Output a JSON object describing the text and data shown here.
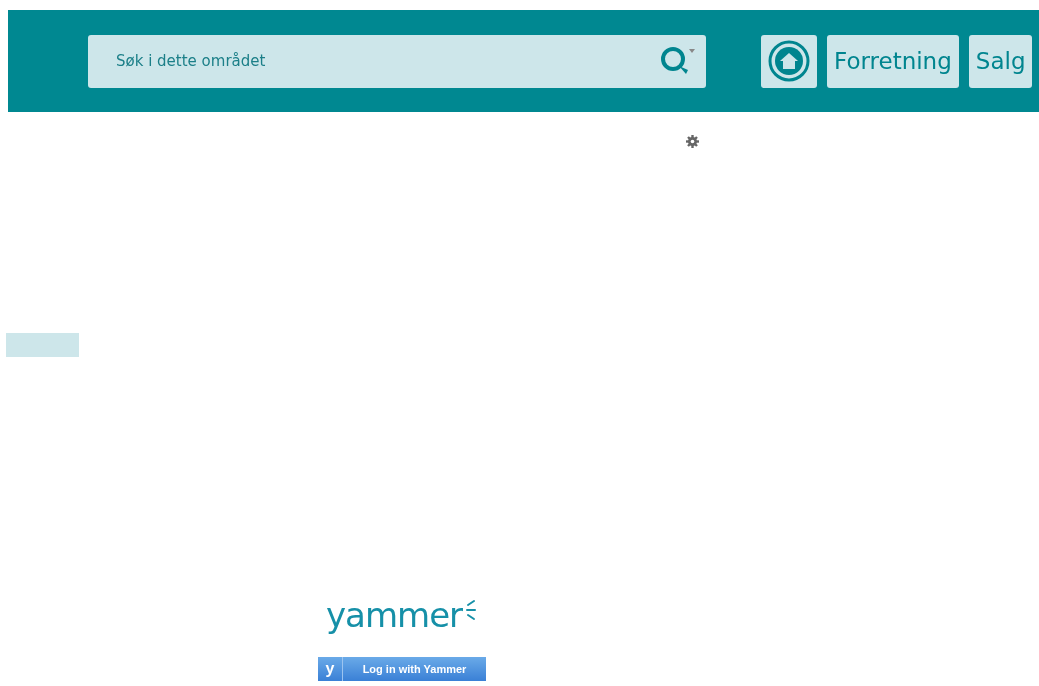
{
  "header": {
    "search": {
      "placeholder": "Søk i dette området"
    },
    "nav": [
      {
        "kind": "home"
      },
      {
        "kind": "link",
        "label": "Forretning"
      },
      {
        "kind": "link",
        "label": "Salg"
      }
    ]
  },
  "yammer": {
    "logo": "yammer",
    "button_mark": "y",
    "button": "Log in with Yammer"
  }
}
